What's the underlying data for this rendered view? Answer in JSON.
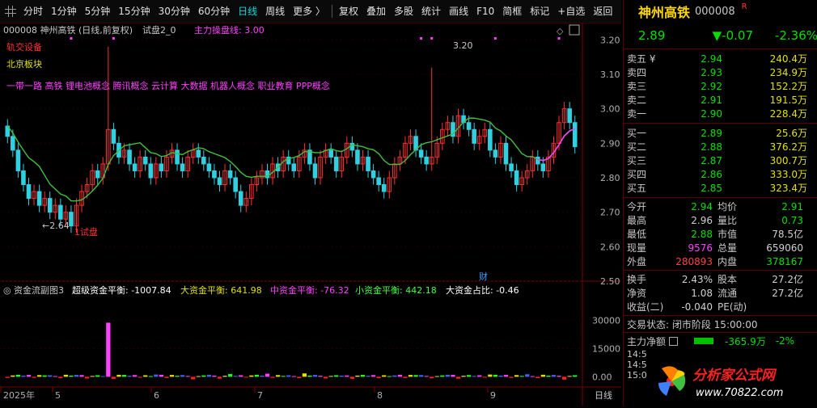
{
  "toolbar": {
    "periods": [
      "分时",
      "1分钟",
      "5分钟",
      "15分钟",
      "30分钟",
      "60分钟",
      "日线",
      "周线",
      "更多 〉"
    ],
    "active_period": "日线",
    "tools": [
      "复权",
      "叠加",
      "多股",
      "统计",
      "画线",
      "F10",
      "简框",
      "标记",
      "+自选",
      "返回"
    ]
  },
  "chart_header": {
    "code_name": "000008 神州高铁 (日线,前复权)",
    "indicator": "试盘2_0",
    "indicator_value": "主力操盘线: 3.00"
  },
  "annotations": {
    "sector1": "轨交设备",
    "sector2": "北京板块",
    "concepts": "一带一路 高铁 锂电池概念 腾讯概念 云计算 大数据 机器人概念 职业教育 PPP概念",
    "low_label": "←2.64",
    "high_label": "3.20",
    "trial_label": "1试盘",
    "cai": "财"
  },
  "y_axis_main": [
    "3.20",
    "3.10",
    "3.00",
    "2.90",
    "2.80",
    "2.70",
    "2.60",
    "2.50"
  ],
  "sub_header": {
    "title": "资金流副图3",
    "super": "超级资金平衡: -1007.84",
    "big": "大资金平衡: 641.98",
    "mid": "中资金平衡: -76.32",
    "small": "小资金平衡: 442.18",
    "ratio": "大资金占比: -0.46"
  },
  "y_axis_sub": [
    "30000",
    "15000",
    "0.00"
  ],
  "x_axis": [
    "2025年",
    "5",
    "6",
    "7",
    "8",
    "9"
  ],
  "x_axis_right": "日线",
  "chart_data": {
    "type": "candlestick",
    "title": "000008 神州高铁 (日线,前复权)",
    "ylim": [
      2.5,
      3.25
    ],
    "high_marker": 3.2,
    "low_marker": 2.64,
    "main_line_last": 3.0,
    "flow_series": {
      "super": -1007.84,
      "big": 641.98,
      "mid": -76.32,
      "small": 442.18,
      "big_ratio": -0.46
    },
    "sub_ylim": [
      -5000,
      38000
    ],
    "colors": {
      "up": "#ff3030",
      "down": "#30d0e0",
      "ma": "#40c040",
      "ma_pink": "#ff40ff"
    }
  },
  "quote": {
    "name": "神州高铁",
    "code": "000008",
    "badge": "R",
    "price": "2.89",
    "change": "▼-0.07",
    "pct": "-2.36%",
    "sell": [
      {
        "label": "卖五 ¥",
        "price": "2.94",
        "vol": "240.4万"
      },
      {
        "label": "卖四",
        "price": "2.93",
        "vol": "234.9万"
      },
      {
        "label": "卖三",
        "price": "2.92",
        "vol": "152.2万"
      },
      {
        "label": "卖二",
        "price": "2.91",
        "vol": "191.5万"
      },
      {
        "label": "卖一",
        "price": "2.90",
        "vol": "228.4万"
      }
    ],
    "buy": [
      {
        "label": "买一",
        "price": "2.89",
        "vol": "25.6万"
      },
      {
        "label": "买二",
        "price": "2.88",
        "vol": "376.2万"
      },
      {
        "label": "买三",
        "price": "2.87",
        "vol": "300.7万"
      },
      {
        "label": "买四",
        "price": "2.86",
        "vol": "333.0万"
      },
      {
        "label": "买五",
        "price": "2.85",
        "vol": "323.4万"
      }
    ],
    "stats": [
      {
        "l1": "今开",
        "v1": "2.94",
        "c1": "g",
        "l2": "均价",
        "v2": "2.91",
        "c2": "g"
      },
      {
        "l1": "最高",
        "v1": "2.96",
        "c1": "w",
        "l2": "量比",
        "v2": "0.73",
        "c2": "g"
      },
      {
        "l1": "最低",
        "v1": "2.88",
        "c1": "g",
        "l2": "市值",
        "v2": "78.5亿",
        "c2": "w"
      },
      {
        "l1": "现量",
        "v1": "9576",
        "c1": "m",
        "l2": "总量",
        "v2": "659060",
        "c2": "w"
      },
      {
        "l1": "外盘",
        "v1": "280893",
        "c1": "r",
        "l2": "内盘",
        "v2": "378167",
        "c2": "g"
      }
    ],
    "stats2": [
      {
        "l1": "换手",
        "v1": "2.43%",
        "l2": "股本",
        "v2": "27.2亿"
      },
      {
        "l1": "净资",
        "v1": "1.08",
        "l2": "流通",
        "v2": "27.2亿"
      },
      {
        "l1": "收益(二)",
        "v1": "-0.040",
        "l2": "PE(动)",
        "v2": ""
      }
    ],
    "status": "交易状态: 闭市阶段 15:00:00",
    "main_net_label": "主力净额",
    "main_net_value": "-365.9万",
    "main_net_pct": "-2%",
    "ticks": [
      "14:5",
      "14:5",
      "15:0"
    ]
  },
  "watermark": {
    "text": "分析家公式网",
    "url": "www.70822.com"
  }
}
